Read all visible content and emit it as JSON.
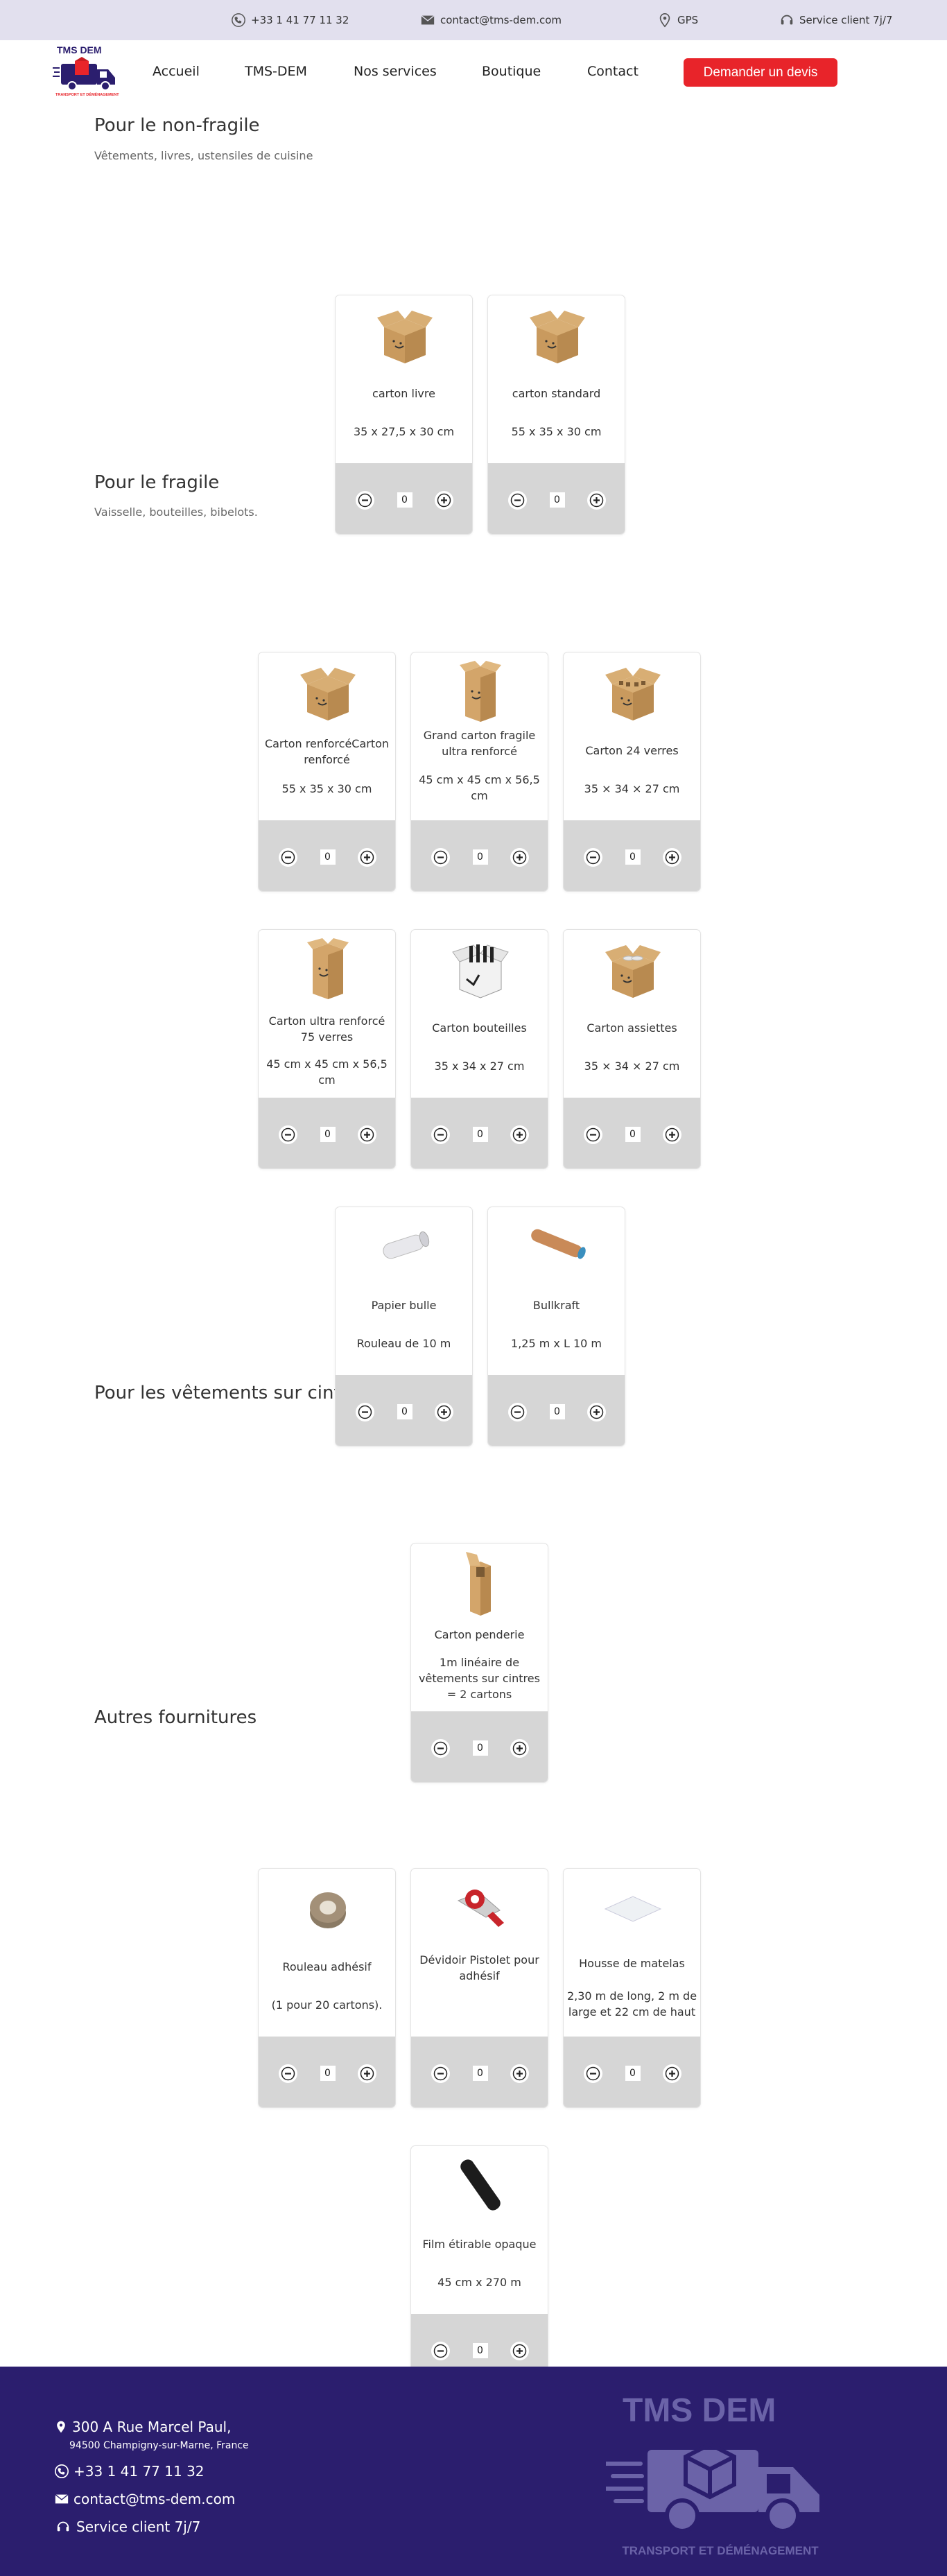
{
  "topbar": {
    "phone": "+33 1 41 77 11 32",
    "email": "contact@tms-dem.com",
    "gps": "GPS",
    "service": "Service client 7j/7"
  },
  "nav": {
    "logo_text": "TMS DEM",
    "logo_tagline": "TRANSPORT ET DÉMÉNAGEMENT",
    "items": [
      "Accueil",
      "TMS-DEM",
      "Nos services",
      "Boutique",
      "Contact"
    ],
    "cta": "Demander un devis"
  },
  "sections": [
    {
      "title": "Pour le non-fragile",
      "subtitle": "Vêtements, livres, ustensiles de cuisine",
      "products": [
        {
          "name": "carton livre",
          "dims": "35 x 27,5 x 30 cm",
          "qty": "0",
          "icon": "open-box"
        },
        {
          "name": "carton standard",
          "dims": "55 x 35 x 30 cm",
          "qty": "0",
          "icon": "open-box"
        }
      ]
    },
    {
      "title": "Pour le fragile",
      "subtitle": "Vaisselle, bouteilles, bibelots.",
      "products": [
        {
          "name": "Carton renforcéCarton renforcé",
          "dims": "55 x 35 x 30 cm",
          "qty": "0",
          "icon": "open-box"
        },
        {
          "name": "Grand carton fragile ultra renforcé",
          "dims": "45 cm x 45 cm x 56,5 cm",
          "qty": "0",
          "icon": "tall-box"
        },
        {
          "name": "Carton 24 verres",
          "dims": "35 × 34 × 27 cm",
          "qty": "0",
          "icon": "glasses-box"
        },
        {
          "name": "Carton ultra renforcé 75 verres",
          "dims": "45 cm x 45 cm x 56,5 cm",
          "qty": "0",
          "icon": "tall-box"
        },
        {
          "name": "Carton bouteilles",
          "dims": "35 x 34 x 27 cm",
          "qty": "0",
          "icon": "bottles-box"
        },
        {
          "name": "Carton assiettes",
          "dims": "35 × 34 × 27 cm",
          "qty": "0",
          "icon": "plates-box"
        },
        {
          "name": "Papier bulle",
          "dims": "Rouleau de 10 m",
          "qty": "0",
          "icon": "bubble-roll"
        },
        {
          "name": "Bullkraft",
          "dims": "1,25 m x L 10 m",
          "qty": "0",
          "icon": "kraft-roll"
        }
      ]
    },
    {
      "title": "Pour les vêtements sur cintre",
      "subtitle": "",
      "products": [
        {
          "name": "Carton penderie",
          "dims": "1m linéaire de vêtements sur cintres = 2 cartons",
          "qty": "0",
          "icon": "wardrobe-box"
        }
      ]
    },
    {
      "title": "Autres fournitures",
      "subtitle": "",
      "products": [
        {
          "name": "Rouleau adhésif",
          "dims": "(1 pour 20 cartons).",
          "qty": "0",
          "icon": "tape-roll"
        },
        {
          "name": "Dévidoir Pistolet pour adhésif",
          "dims": "",
          "qty": "0",
          "icon": "tape-gun"
        },
        {
          "name": "Housse de matelas",
          "dims": "2,30 m de long, 2 m de large et 22 cm de haut",
          "qty": "0",
          "icon": "mattress-cover"
        },
        {
          "name": "Film étirable opaque",
          "dims": "45 cm x 270 m",
          "qty": "0",
          "icon": "stretch-film"
        }
      ]
    }
  ],
  "footer": {
    "address_line1": "300 A Rue Marcel Paul,",
    "address_line2": "94500 Champigny-sur-Marne, France",
    "phone": "+33 1 41 77 11 32",
    "email": "contact@tms-dem.com",
    "service": "Service client 7j/7",
    "logo_text": "TMS DEM",
    "logo_tagline": "TRANSPORT ET DÉMÉNAGEMENT"
  },
  "colors": {
    "accent": "#e8242a",
    "footer_bg": "#2b1e6e",
    "topbar_bg": "#e2e0ee",
    "card_bottom": "#d6d6d6"
  }
}
